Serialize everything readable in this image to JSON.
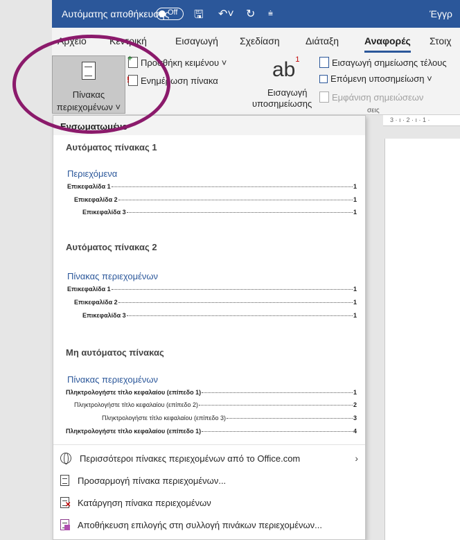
{
  "titlebar": {
    "autosave_label": "Αυτόματης αποθήκευσης",
    "autosave_state": "Off",
    "doc_title": "Έγγρ"
  },
  "tabs": [
    "Αρχείο",
    "Κεντρική",
    "Εισαγωγή",
    "Σχεδίαση",
    "Διάταξη",
    "Αναφορές",
    "Στοιχ"
  ],
  "active_tab": "Αναφορές",
  "ribbon": {
    "toc_button_line1": "Πίνακας",
    "toc_button_line2": "περιεχομένων ˅",
    "add_text": "Προσθήκη κειμένου ˅",
    "update_table": "Ενημέρωση πίνακα",
    "insert_footnote_line1": "Εισαγωγή",
    "insert_footnote_line2": "υποσημείωσης",
    "insert_endnote": "Εισαγωγή σημείωσης τέλους",
    "next_footnote": "Επόμενη υποσημείωση ˅",
    "show_notes": "Εμφάνιση σημειώσεων",
    "group_label_partial": "σεις",
    "ab_glyph": "ab",
    "ab_sup": "1"
  },
  "ruler_text": "3 · ı · 2 · ı · 1 ·",
  "menu": {
    "header": "Ενσωματωμένο",
    "auto1": {
      "title": "Αυτόματος πίνακας 1",
      "heading": "Περιεχόμενα",
      "rows": [
        {
          "text": "Επικεφαλίδα 1",
          "page": "1"
        },
        {
          "text": "Επικεφαλίδα 2",
          "page": "1"
        },
        {
          "text": "Επικεφαλίδα 3",
          "page": "1"
        }
      ]
    },
    "auto2": {
      "title": "Αυτόματος πίνακας 2",
      "heading": "Πίνακας περιεχομένων",
      "rows": [
        {
          "text": "Επικεφαλίδα 1",
          "page": "1"
        },
        {
          "text": "Επικεφαλίδα 2",
          "page": "1"
        },
        {
          "text": "Επικεφαλίδα 3",
          "page": "1"
        }
      ]
    },
    "manual": {
      "title": "Μη αυτόματος πίνακας",
      "heading": "Πίνακας περιεχομένων",
      "rows": [
        {
          "text": "Πληκτρολογήστε τίτλο κεφαλαίου (επίπεδο 1)",
          "page": "1"
        },
        {
          "text": "Πληκτρολογήστε τίτλο κεφαλαίου (επίπεδο 2)",
          "page": "2"
        },
        {
          "text": "Πληκτρολογήστε τίτλο κεφαλαίου (επίπεδο 3)",
          "page": "3"
        },
        {
          "text": "Πληκτρολογήστε τίτλο κεφαλαίου (επίπεδο 1)",
          "page": "4"
        }
      ]
    },
    "actions": {
      "more_office": "Περισσότεροι πίνακες περιεχομένων από το Office.com",
      "custom": "Προσαρμογή πίνακα περιεχομένων...",
      "remove": "Κατάργηση πίνακα περιεχομένων",
      "save": "Αποθήκευση επιλογής στη συλλογή πινάκων περιεχομένων..."
    }
  },
  "colors": {
    "titlebar": "#2b579a",
    "annotation_circle": "#8b1a6b",
    "heading_blue": "#2b579a"
  }
}
